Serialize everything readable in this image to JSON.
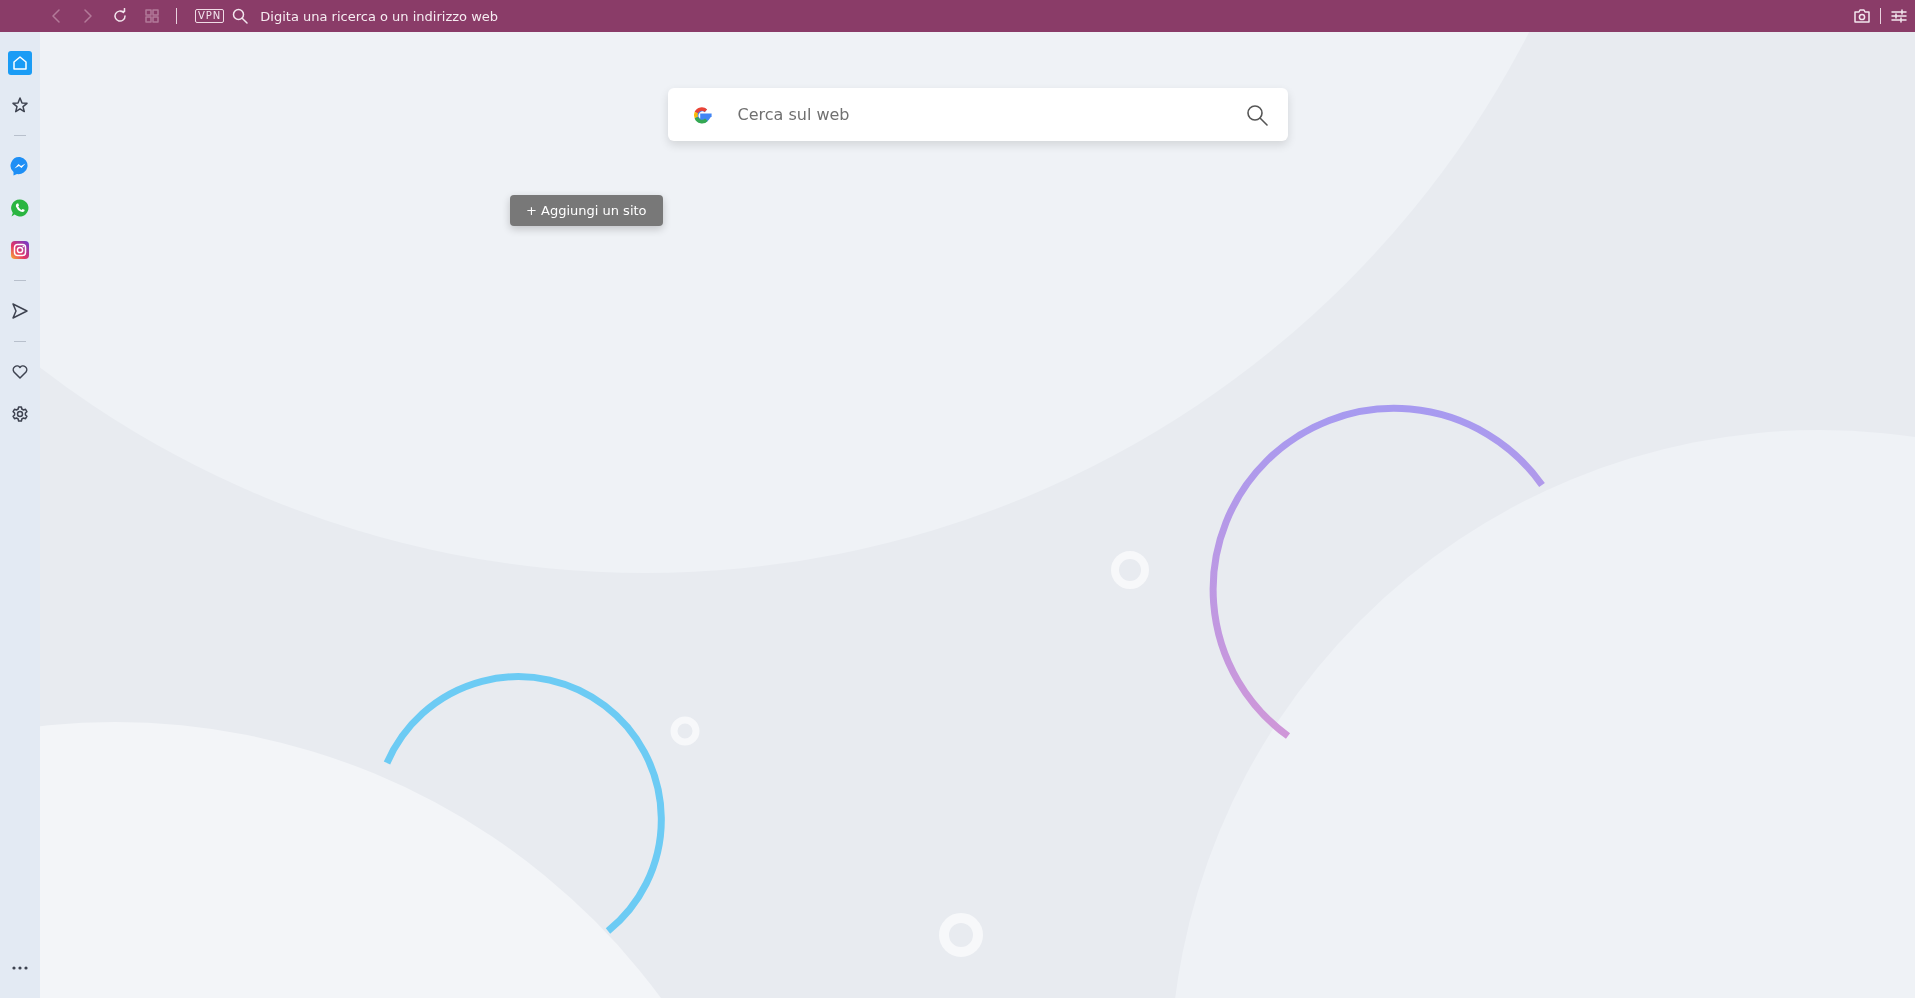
{
  "toolbar": {
    "back": {
      "disabled": true
    },
    "forward": {
      "disabled": true
    },
    "vpn_badge": "VPN",
    "address_field": {
      "placeholder": "Digita una ricerca o un indirizzo web"
    }
  },
  "sidebar": {
    "items": [
      {
        "kind": "button",
        "selected": true
      },
      {
        "kind": "button",
        "selected": false
      },
      {
        "kind": "separator"
      },
      {
        "kind": "button",
        "selected": false
      },
      {
        "kind": "button",
        "selected": false
      },
      {
        "kind": "button",
        "selected": false
      },
      {
        "kind": "separator"
      },
      {
        "kind": "button",
        "selected": false
      },
      {
        "kind": "separator"
      },
      {
        "kind": "button",
        "selected": false
      },
      {
        "kind": "button",
        "selected": false
      }
    ]
  },
  "search": {
    "placeholder": "Cerca sul web"
  },
  "add_site_button": "+ Aggiungi un sito"
}
